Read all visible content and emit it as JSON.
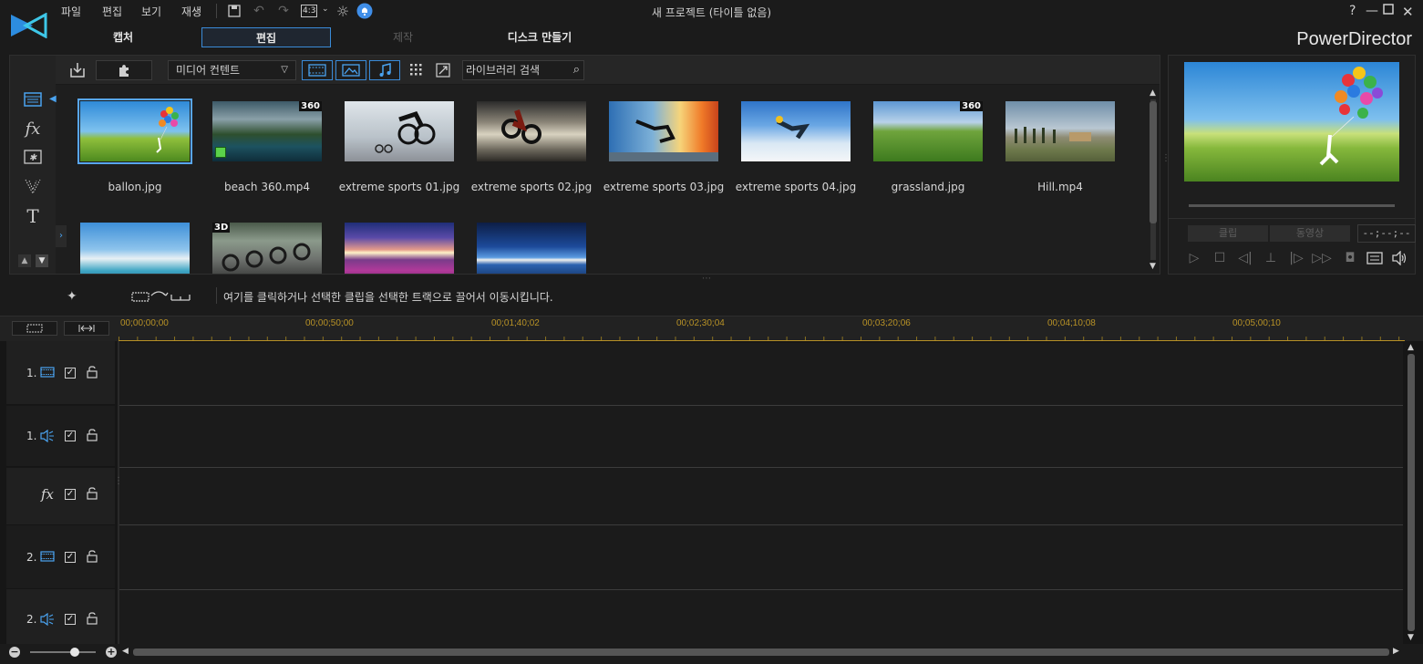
{
  "menu": [
    "파일",
    "편집",
    "보기",
    "재생"
  ],
  "toolbar": {
    "aspect": "4:3"
  },
  "window": {
    "title": "새 프로젝트 (타이틀 없음)",
    "help": "?"
  },
  "modes": {
    "capture": "캡처",
    "edit": "편집",
    "produce": "제작",
    "disc": "디스크 만들기"
  },
  "brand": "PowerDirector",
  "library": {
    "media_filter": "미디어 컨텐트",
    "search_placeholder": "라이브러리 검색",
    "items": [
      {
        "name": "ballon.jpg",
        "badge": ""
      },
      {
        "name": "beach 360.mp4",
        "badge": "360"
      },
      {
        "name": "extreme sports 01.jpg",
        "badge": ""
      },
      {
        "name": "extreme sports 02.jpg",
        "badge": ""
      },
      {
        "name": "extreme sports 03.jpg",
        "badge": ""
      },
      {
        "name": "extreme sports 04.jpg",
        "badge": ""
      },
      {
        "name": "grassland.jpg",
        "badge": "360"
      },
      {
        "name": "Hill.mp4",
        "badge": ""
      },
      {
        "name": "",
        "badge": ""
      },
      {
        "name": "",
        "badge": "3D"
      },
      {
        "name": "",
        "badge": ""
      },
      {
        "name": "",
        "badge": ""
      }
    ]
  },
  "preview": {
    "tab_clip": "클립",
    "tab_movie": "동영상",
    "timecode": "--;--;--"
  },
  "hint": "여기를 클릭하거나 선택한 클립을 선택한 트랙으로 끌어서 이동시킵니다.",
  "timeline": {
    "timecodes": [
      "00;00;00;00",
      "00;00;50;00",
      "00;01;40;02",
      "00;02;30;04",
      "00;03;20;06",
      "00;04;10;08",
      "00;05;00;10"
    ],
    "tracks": [
      {
        "label": "1.",
        "type": "video"
      },
      {
        "label": "1.",
        "type": "audio"
      },
      {
        "label": "",
        "type": "fx"
      },
      {
        "label": "2.",
        "type": "video"
      },
      {
        "label": "2.",
        "type": "audio"
      }
    ]
  },
  "colors": {
    "accent": "#3a8bd8",
    "timecode": "#b89226",
    "icon_blue": "#4aa3f0"
  }
}
